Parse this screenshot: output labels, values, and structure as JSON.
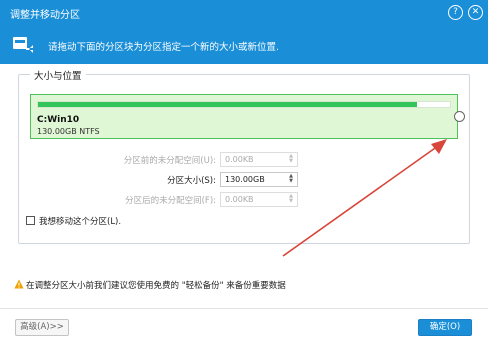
{
  "window": {
    "title": "调整并移动分区",
    "help_glyph": "?",
    "close_glyph": "✕"
  },
  "banner": {
    "icon": "partition-move-icon",
    "text": "请拖动下面的分区块为分区指定一个新的大小或新位置."
  },
  "group": {
    "label": "大小与位置",
    "partition": {
      "name": "C:Win10",
      "info": "130.00GB NTFS",
      "used_fraction": 0.92,
      "color": "#33c45a"
    }
  },
  "fields": {
    "before": {
      "label": "分区前的未分配空间(U):",
      "value": "0.00KB"
    },
    "size": {
      "label": "分区大小(S):",
      "value": "130.00GB"
    },
    "after": {
      "label": "分区后的未分配空间(F):",
      "value": "0.00KB"
    }
  },
  "checkbox": {
    "label": "我想移动这个分区(L).",
    "checked": false
  },
  "warning": {
    "icon": "warning-icon",
    "text": "在调整分区大小前我们建议您使用免费的 \"轻松备份\" 来备份重要数据"
  },
  "footer": {
    "advanced_label": "高级(A)>>",
    "ok_label": "确定(O)"
  },
  "colors": {
    "accent": "#1a8fd8",
    "partition_bg": "#dff7d4",
    "bar": "#33c45a",
    "annotation_arrow": "#d9463a"
  }
}
